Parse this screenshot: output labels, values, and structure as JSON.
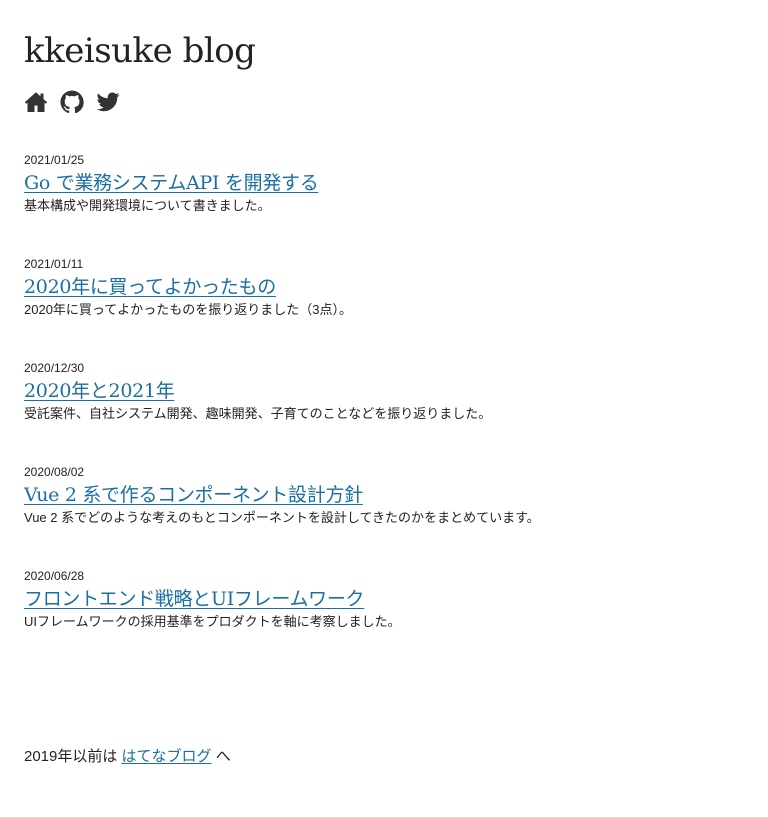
{
  "site": {
    "title": "kkeisuke blog"
  },
  "social": [
    {
      "icon": "home-icon"
    },
    {
      "icon": "github-icon"
    },
    {
      "icon": "twitter-icon"
    }
  ],
  "posts": [
    {
      "date": "2021/01/25",
      "title": "Go で業務システムAPI を開発する",
      "summary": "基本構成や開発環境について書きました。"
    },
    {
      "date": "2021/01/11",
      "title": "2020年に買ってよかったもの",
      "summary": "2020年に買ってよかったものを振り返りました（3点）。"
    },
    {
      "date": "2020/12/30",
      "title": "2020年と2021年",
      "summary": "受託案件、自社システム開発、趣味開発、子育てのことなどを振り返りました。"
    },
    {
      "date": "2020/08/02",
      "title": "Vue 2 系で作るコンポーネント設計方針",
      "summary": "Vue 2 系でどのような考えのもとコンポーネントを設計してきたのかをまとめています。"
    },
    {
      "date": "2020/06/28",
      "title": "フロントエンド戦略とUIフレームワーク",
      "summary": "UIフレームワークの採用基準をプロダクトを軸に考察しました。"
    }
  ],
  "footer": {
    "prefix": "2019年以前は ",
    "link_label": "はてなブログ",
    "suffix": " へ"
  },
  "colors": {
    "link": "#1a6fa3",
    "text": "#222222",
    "icon": "#333333"
  }
}
